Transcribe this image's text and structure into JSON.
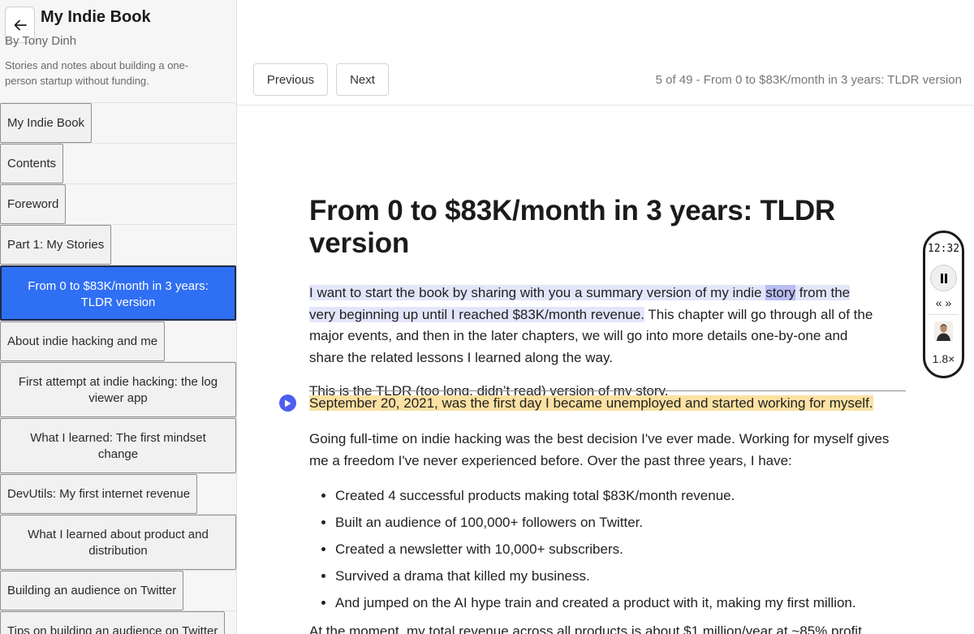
{
  "sidebar": {
    "book_title": "My Indie Book",
    "author": "By Tony Dinh",
    "description": "Stories and notes about building a one-person startup without funding.",
    "items": [
      {
        "label": "My Indie Book"
      },
      {
        "label": "Contents"
      },
      {
        "label": "Foreword"
      },
      {
        "label": "Part 1: My Stories"
      },
      {
        "label": "From 0 to $83K/month in 3 years: TLDR version",
        "active": true
      },
      {
        "label": "About indie hacking and me"
      },
      {
        "label": "First attempt at indie hacking: the log viewer app"
      },
      {
        "label": "What I learned: The first mindset change"
      },
      {
        "label": "DevUtils: My first internet revenue"
      },
      {
        "label": "What I learned about product and distribution"
      },
      {
        "label": "Building an audience on Twitter"
      },
      {
        "label": "Tips on building an audience on Twitter"
      }
    ]
  },
  "toolbar": {
    "previous_label": "Previous",
    "next_label": "Next",
    "chapter_position": "5 of 49 - From 0 to $83K/month in 3 years: TLDR version"
  },
  "chapter": {
    "title": "From 0 to $83K/month in 3 years: TLDR version",
    "p1_hl_a": "I want to start the book by sharing with you a summary version of my indie ",
    "p1_hl_word": "story",
    "p1_hl_b": " from the very beginning up until I reached $83K/month revenue.",
    "p1_rest": " This chapter will go through all of the major events, and then in the later chapters, we will go into more details one-by-one and share the related lessons I learned along the way.",
    "p2": "This is the TLDR (too long, didn’t read) version of my story.",
    "p3": "September 20, 2021, was the first day I became unemployed and started working for myself.",
    "p4": "Going full-time on indie hacking was the best decision I've ever made. Working for myself gives me a freedom I've never experienced before. Over the past three years, I have:",
    "bullets": [
      "Created 4 successful products making total $83K/month revenue.",
      "Built an audience of 100,000+ followers on Twitter.",
      "Created a newsletter with 10,000+ subscribers.",
      "Survived a drama that killed my business.",
      "And jumped on the AI hype train and created a product with it, making my first million."
    ],
    "p5": "At the moment, my total revenue across all products is about $1 million/year at ~85% profit"
  },
  "player": {
    "time": "12:32",
    "skip_label": "« »",
    "speed": "1.8×"
  },
  "colors": {
    "accent": "#2f6ff3",
    "highlight_blue": "#e3e5fb",
    "highlight_yellow": "#fbe1a3",
    "play_dot": "#4f5df0"
  }
}
